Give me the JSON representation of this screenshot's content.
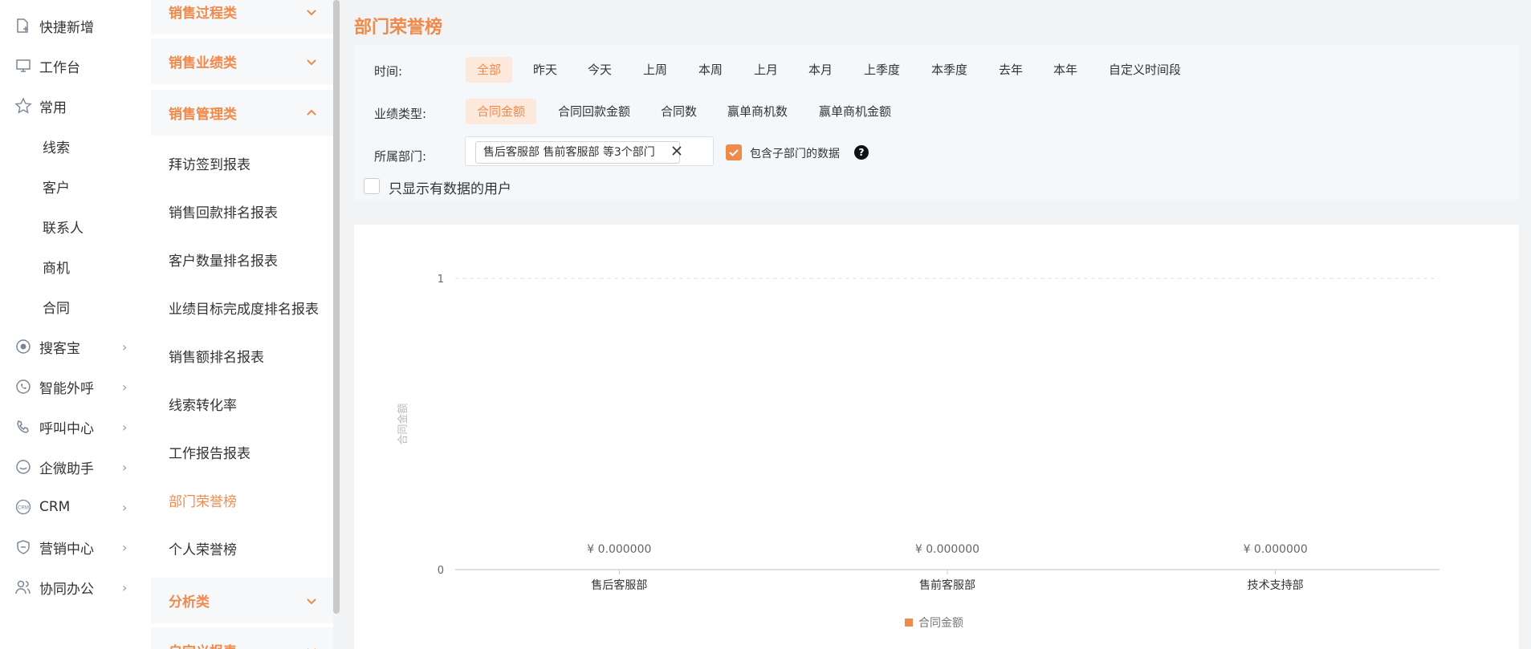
{
  "sidebar": {
    "items": [
      {
        "label": "快捷新增",
        "icon": "add-file-icon"
      },
      {
        "label": "工作台",
        "icon": "monitor-icon"
      },
      {
        "label": "常用",
        "icon": "star-icon"
      },
      {
        "label": "线索"
      },
      {
        "label": "客户"
      },
      {
        "label": "联系人"
      },
      {
        "label": "商机"
      },
      {
        "label": "合同"
      },
      {
        "label": "搜客宝",
        "icon": "search-compass-icon",
        "chevron": "›"
      },
      {
        "label": "智能外呼",
        "icon": "whatsapp-phone-icon",
        "chevron": "›"
      },
      {
        "label": "呼叫中心",
        "icon": "phone-call-icon",
        "chevron": "›"
      },
      {
        "label": "企微助手",
        "icon": "wechat-work-icon",
        "chevron": "›"
      },
      {
        "label": "CRM",
        "icon": "crm-icon",
        "chevron": "›"
      },
      {
        "label": "营销中心",
        "icon": "marketing-shield-icon",
        "chevron": "›"
      },
      {
        "label": "协同办公",
        "icon": "users-icon",
        "chevron": "›"
      }
    ]
  },
  "report_menu": {
    "categories": {
      "sales_process": "销售过程类",
      "sales_performance": "销售业绩类",
      "sales_management": "销售管理类",
      "analysis": "分析类",
      "custom": "自定义报表"
    },
    "items": [
      "拜访签到报表",
      "销售回款排名报表",
      "客户数量排名报表",
      "业绩目标完成度排名报表",
      "销售额排名报表",
      "线索转化率",
      "工作报告报表",
      "部门荣誉榜",
      "个人荣誉榜"
    ],
    "active_index": 7
  },
  "page": {
    "title": "部门荣誉榜"
  },
  "filters": {
    "time_label": "时间:",
    "time_options": [
      "全部",
      "昨天",
      "今天",
      "上周",
      "本周",
      "上月",
      "本月",
      "上季度",
      "本季度",
      "去年",
      "本年",
      "自定义时间段"
    ],
    "time_selected": 0,
    "type_label": "业绩类型:",
    "type_options": [
      "合同金额",
      "合同回款金额",
      "合同数",
      "赢单商机数",
      "赢单商机金额"
    ],
    "type_selected": 0,
    "dept_label": "所属部门:",
    "dept_tag": "售后客服部 售前客服部 等3个部门",
    "include_sub_label": "包含子部门的数据",
    "include_sub_checked": true,
    "only_with_data_label": "只显示有数据的用户",
    "only_with_data_checked": false
  },
  "colors": {
    "accent": "#f08a4b",
    "accent_light": "#fde9dc",
    "axis": "#cccccc"
  },
  "chart_data": {
    "type": "bar",
    "categories": [
      "售后客服部",
      "售前客服部",
      "技术支持部"
    ],
    "series": [
      {
        "name": "合同金额",
        "values": [
          0,
          0,
          0
        ]
      }
    ],
    "data_labels": [
      "¥ 0.000000",
      "¥ 0.000000",
      "¥ 0.000000"
    ],
    "ylabel": "合同金额",
    "ylim": [
      0,
      1
    ],
    "yticks": [
      0,
      1
    ],
    "legend": "bottom-center"
  }
}
